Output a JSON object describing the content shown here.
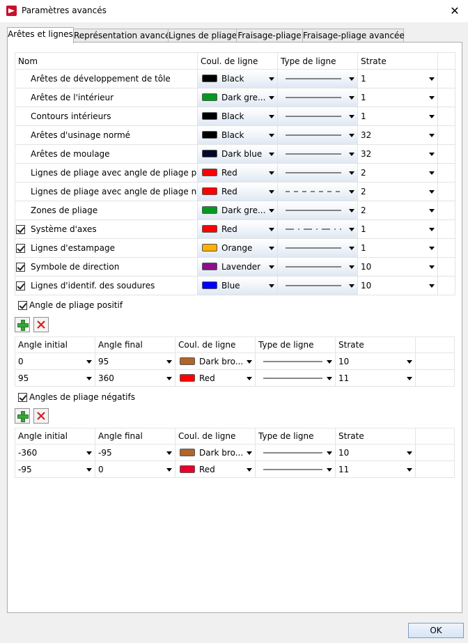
{
  "window": {
    "title": "Paramètres avancés",
    "close_glyph": "✕",
    "icon": "app-icon"
  },
  "tabs": [
    {
      "label": "Arêtes et lignes",
      "active": true
    },
    {
      "label": "Représentation avancée",
      "active": false
    },
    {
      "label": "Lignes de pliage",
      "active": false
    },
    {
      "label": "Fraisage-pliage",
      "active": false
    },
    {
      "label": "Fraisage-pliage avancée",
      "active": false
    }
  ],
  "edge_table": {
    "headers": {
      "name": "Nom",
      "color": "Coul. de ligne",
      "linetype": "Type de ligne",
      "layer": "Strate"
    },
    "rows": [
      {
        "checkbox": false,
        "checked": false,
        "name": "Arêtes de développement de tôle",
        "color_name": "Black",
        "color_hex": "#000000",
        "line": "solid",
        "layer": "1"
      },
      {
        "checkbox": false,
        "checked": false,
        "name": "Arêtes de l'intérieur",
        "color_name": "Dark gre...",
        "color_hex": "#009a1f",
        "line": "solid",
        "layer": "1"
      },
      {
        "checkbox": false,
        "checked": false,
        "name": "Contours intérieurs",
        "color_name": "Black",
        "color_hex": "#000000",
        "line": "solid",
        "layer": "1"
      },
      {
        "checkbox": false,
        "checked": false,
        "name": "Arêtes d'usinage normé",
        "color_name": "Black",
        "color_hex": "#000000",
        "line": "solid",
        "layer": "32"
      },
      {
        "checkbox": false,
        "checked": false,
        "name": "Arêtes de moulage",
        "color_name": "Dark blue",
        "color_hex": "#03082a",
        "line": "solid",
        "layer": "32"
      },
      {
        "checkbox": false,
        "checked": false,
        "name": "Lignes de pliage avec angle de pliage positif",
        "color_name": "Red",
        "color_hex": "#ff0000",
        "line": "solid",
        "layer": "2"
      },
      {
        "checkbox": false,
        "checked": false,
        "name": "Lignes de pliage avec angle de pliage négatif",
        "color_name": "Red",
        "color_hex": "#ff0000",
        "line": "dashed",
        "layer": "2"
      },
      {
        "checkbox": false,
        "checked": false,
        "name": "Zones de pliage",
        "color_name": "Dark gre...",
        "color_hex": "#009a1f",
        "line": "solid",
        "layer": "2"
      },
      {
        "checkbox": true,
        "checked": true,
        "name": "Système d'axes",
        "color_name": "Red",
        "color_hex": "#ff0000",
        "line": "dashdot",
        "layer": "1"
      },
      {
        "checkbox": true,
        "checked": true,
        "name": "Lignes d'estampage",
        "color_name": "Orange",
        "color_hex": "#ffb000",
        "line": "solid",
        "layer": "1"
      },
      {
        "checkbox": true,
        "checked": true,
        "name": "Symbole de direction",
        "color_name": "Lavender",
        "color_hex": "#8b0f8b",
        "line": "solid",
        "layer": "10"
      },
      {
        "checkbox": true,
        "checked": true,
        "name": "Lignes d'identif. des soudures",
        "color_name": "Blue",
        "color_hex": "#0000ff",
        "line": "solid",
        "layer": "10"
      }
    ]
  },
  "positive_group": {
    "label": "Angle de pliage positif",
    "checked": true,
    "headers": {
      "start": "Angle initial",
      "end": "Angle final",
      "color": "Coul. de ligne",
      "linetype": "Type de ligne",
      "layer": "Strate"
    },
    "rows": [
      {
        "start": "0",
        "end": "95",
        "color_name": "Dark bro...",
        "color_hex": "#b0662a",
        "line": "solid",
        "layer": "10"
      },
      {
        "start": "95",
        "end": "360",
        "color_name": "Red",
        "color_hex": "#ff0000",
        "line": "solid",
        "layer": "11"
      }
    ]
  },
  "negative_group": {
    "label": "Angles de pliage négatifs",
    "checked": true,
    "headers": {
      "start": "Angle initial",
      "end": "Angle final",
      "color": "Coul. de ligne",
      "linetype": "Type de ligne",
      "layer": "Strate"
    },
    "rows": [
      {
        "start": "-360",
        "end": "-95",
        "color_name": "Dark bro...",
        "color_hex": "#b0662a",
        "line": "solid",
        "layer": "10"
      },
      {
        "start": "-95",
        "end": "0",
        "color_name": "Red",
        "color_hex": "#e8002a",
        "line": "solid",
        "layer": "11"
      }
    ]
  },
  "footer": {
    "ok_label": "OK"
  }
}
